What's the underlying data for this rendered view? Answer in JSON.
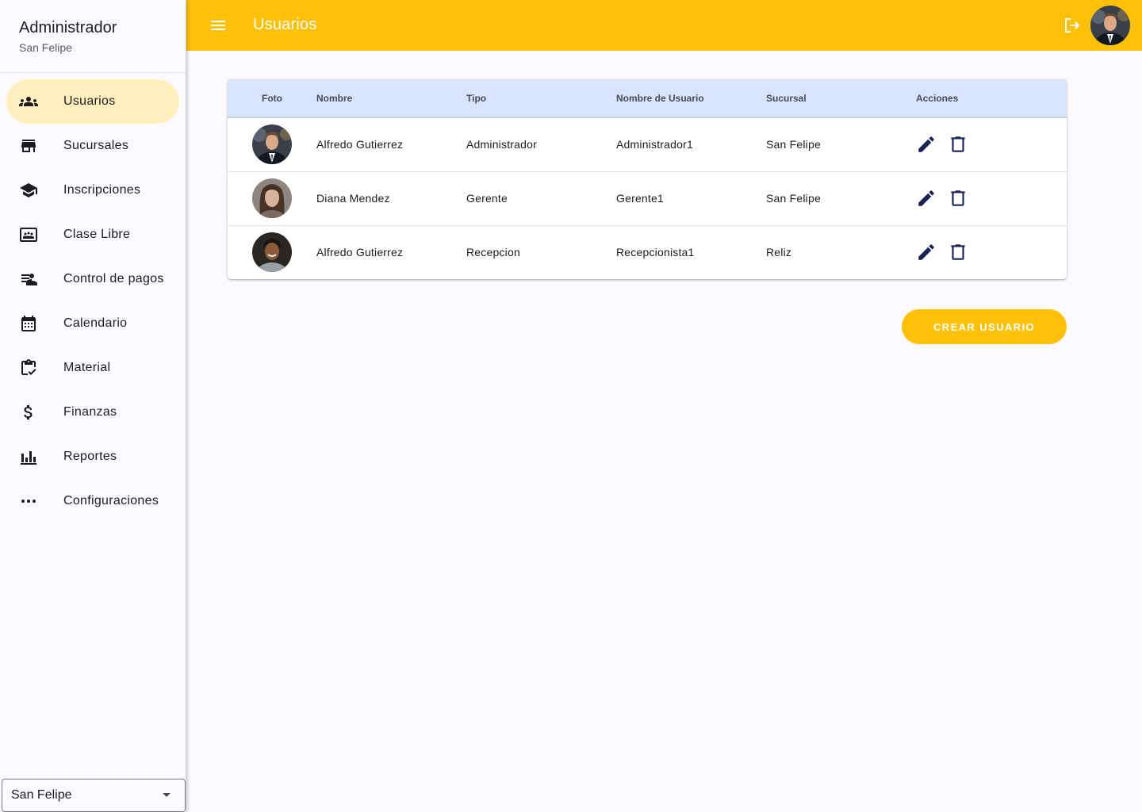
{
  "sidebar": {
    "title": "Administrador",
    "subtitle": "San Felipe",
    "items": [
      {
        "label": "Usuarios",
        "icon": "group-icon",
        "active": true
      },
      {
        "label": "Sucursales",
        "icon": "store-icon"
      },
      {
        "label": "Inscripciones",
        "icon": "school-icon"
      },
      {
        "label": "Clase Libre",
        "icon": "co-present-icon"
      },
      {
        "label": "Control de pagos",
        "icon": "person-search-icon"
      },
      {
        "label": "Calendario",
        "icon": "calendar-icon"
      },
      {
        "label": "Material",
        "icon": "clipboard-check-icon"
      },
      {
        "label": "Finanzas",
        "icon": "dollar-icon"
      },
      {
        "label": "Reportes",
        "icon": "bar-chart-icon"
      },
      {
        "label": "Configuraciones",
        "icon": "more-horiz-icon"
      }
    ],
    "branch_select": {
      "value": "San Felipe"
    }
  },
  "topbar": {
    "title": "Usuarios",
    "menu_icon": "menu-icon",
    "logout_icon": "logout-icon"
  },
  "table": {
    "headers": {
      "foto": "Foto",
      "nombre": "Nombre",
      "tipo": "Tipo",
      "usuario": "Nombre de Usuario",
      "sucursal": "Sucursal",
      "acciones": "Acciones"
    },
    "rows": [
      {
        "nombre": "Alfredo Gutierrez",
        "tipo": "Administrador",
        "usuario": "Administrador1",
        "sucursal": "San Felipe"
      },
      {
        "nombre": "Diana Mendez",
        "tipo": "Gerente",
        "usuario": "Gerente1",
        "sucursal": "San Felipe"
      },
      {
        "nombre": "Alfredo Gutierrez",
        "tipo": "Recepcion",
        "usuario": "Recepcionista1",
        "sucursal": "Reliz"
      }
    ]
  },
  "actions": {
    "create_label": "CREAR USUARIO"
  },
  "colors": {
    "primary": "#ffc107",
    "active_nav": "#ffefbf",
    "table_header": "#d8e4fd",
    "action_icon": "#1a2354"
  }
}
